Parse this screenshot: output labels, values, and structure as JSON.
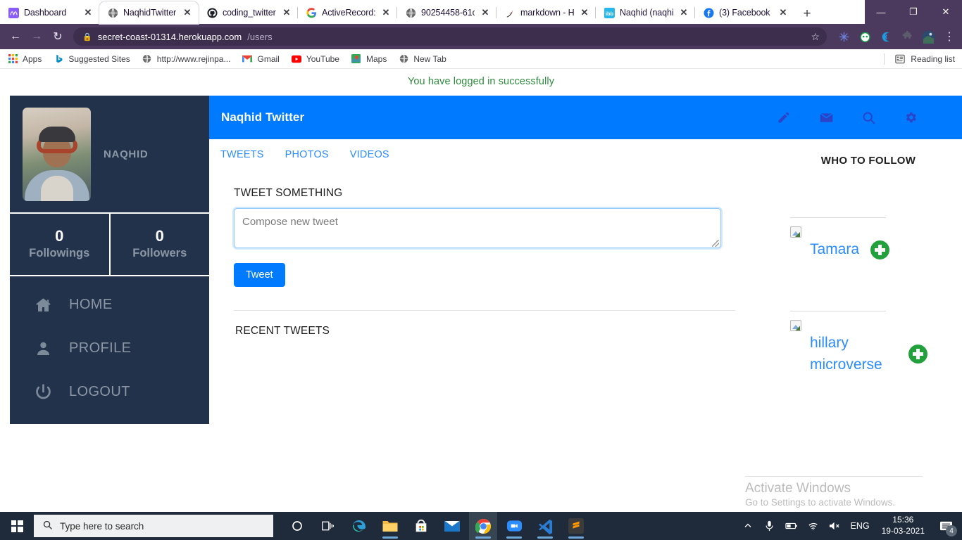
{
  "browser": {
    "tabs": [
      {
        "title": "Dashboard",
        "favicon": "atlassian-icon",
        "active": false
      },
      {
        "title": "NaqhidTwitter",
        "favicon": "globe-icon",
        "active": true
      },
      {
        "title": "coding_twitter",
        "favicon": "github-icon",
        "active": false
      },
      {
        "title": "ActiveRecord::",
        "favicon": "google-icon",
        "active": false
      },
      {
        "title": "90254458-61c",
        "favicon": "globe-icon",
        "active": false
      },
      {
        "title": "markdown - H",
        "favicon": "jekyll-icon",
        "active": false
      },
      {
        "title": "Naqhid (naqhi",
        "favicon": "ibb-icon",
        "active": false
      },
      {
        "title": "(3) Facebook",
        "favicon": "facebook-icon",
        "active": false
      }
    ],
    "new_tab_label": "+",
    "window_controls": {
      "minimize": "—",
      "maximize": "❐",
      "close": "✕"
    },
    "nav": {
      "back": "←",
      "forward": "→",
      "reload": "↻"
    },
    "omnibox": {
      "lock_icon": "lock-icon",
      "url_host": "secret-coast-01314.herokuapp.com",
      "url_path": "/users",
      "star_icon": "star-icon"
    },
    "extensions": [
      "snowflake-extension-icon",
      "grammarly-extension-icon",
      "clickup-extension-icon",
      "puzzle-extensions-icon",
      "profile-avatar-icon"
    ],
    "menu_icon": "kebab-menu-icon",
    "bookmarks": [
      {
        "label": "Apps",
        "icon": "apps-grid-icon"
      },
      {
        "label": "Suggested Sites",
        "icon": "bing-icon"
      },
      {
        "label": "http://www.rejinpa...",
        "icon": "globe-icon"
      },
      {
        "label": "Gmail",
        "icon": "gmail-icon"
      },
      {
        "label": "YouTube",
        "icon": "youtube-icon"
      },
      {
        "label": "Maps",
        "icon": "maps-icon"
      },
      {
        "label": "New Tab",
        "icon": "globe-icon"
      }
    ],
    "reading_list": {
      "label": "Reading list",
      "icon": "reading-list-icon"
    }
  },
  "page": {
    "flash_message": "You have logged in successfully",
    "flash_color": "#2e8b3d",
    "sidebar": {
      "avatar": "user-profile-photo",
      "username": "NAQHID",
      "stats": [
        {
          "value": "0",
          "label": "Followings"
        },
        {
          "value": "0",
          "label": "Followers"
        }
      ],
      "nav": [
        {
          "label": "HOME",
          "icon": "home-icon"
        },
        {
          "label": "PROFILE",
          "icon": "person-icon"
        },
        {
          "label": "LOGOUT",
          "icon": "power-icon"
        }
      ]
    },
    "appbar": {
      "title": "Naqhid Twitter",
      "background": "#007bff",
      "icons": [
        "pencil-icon",
        "envelope-icon",
        "search-icon",
        "gear-icon"
      ]
    },
    "tabs": [
      {
        "label": "TWEETS"
      },
      {
        "label": "PHOTOS"
      },
      {
        "label": "VIDEOS"
      }
    ],
    "compose": {
      "label": "TWEET SOMETHING",
      "placeholder": "Compose new tweet",
      "value": "",
      "button_label": "Tweet",
      "button_color": "#007bff"
    },
    "recent_tweets_label": "RECENT TWEETS",
    "who_to_follow": {
      "title": "WHO TO FOLLOW",
      "users": [
        {
          "name": "Tamara",
          "avatar": "broken-image-icon",
          "action": "follow-plus-icon"
        },
        {
          "name": "hillary microverse",
          "avatar": "broken-image-icon",
          "action": "follow-plus-icon"
        }
      ]
    },
    "watermark": {
      "title": "Activate Windows",
      "subtitle": "Go to Settings to activate Windows."
    }
  },
  "taskbar": {
    "start_icon": "windows-start-icon",
    "search_placeholder": "Type here to search",
    "search_icon": "search-icon",
    "system_icons": [
      "cortana-icon",
      "task-view-icon"
    ],
    "apps": [
      {
        "name": "edge-icon",
        "running": false
      },
      {
        "name": "file-explorer-icon",
        "running": true
      },
      {
        "name": "microsoft-store-icon",
        "running": false
      },
      {
        "name": "mail-icon",
        "running": false
      },
      {
        "name": "chrome-icon",
        "running": true,
        "active": true
      },
      {
        "name": "zoom-icon",
        "running": true
      },
      {
        "name": "vscode-icon",
        "running": true
      },
      {
        "name": "sublime-text-icon",
        "running": true
      }
    ],
    "tray": {
      "chevron": "show-hidden-icons",
      "icons": [
        "microphone-icon",
        "battery-icon",
        "wifi-icon",
        "volume-muted-icon"
      ],
      "language": "ENG",
      "time": "15:36",
      "date": "19-03-2021",
      "notification_count": "4"
    }
  }
}
